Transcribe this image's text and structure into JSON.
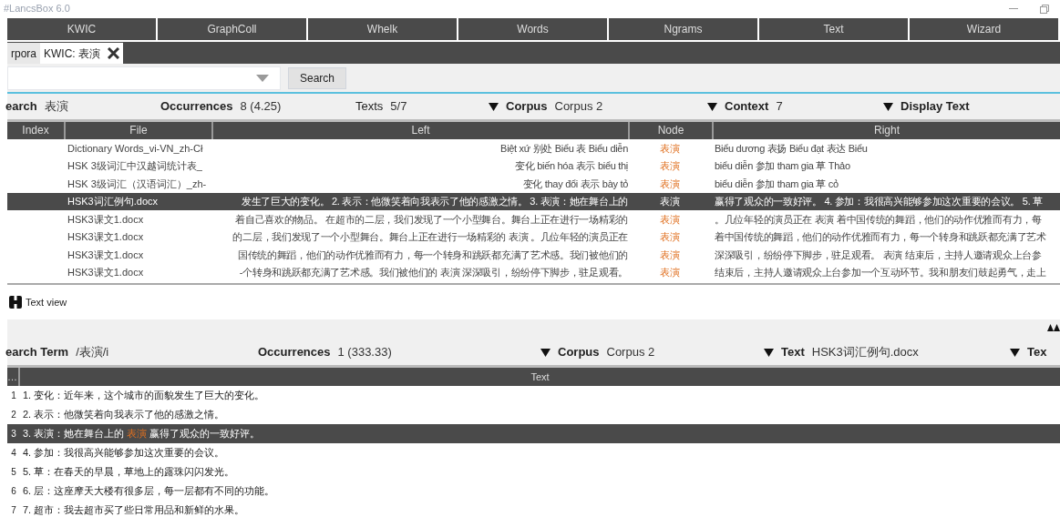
{
  "window": {
    "title": "#LancsBox 6.0"
  },
  "modules": [
    {
      "label": "KWIC",
      "selected": false
    },
    {
      "label": "GraphColl",
      "selected": false
    },
    {
      "label": "Whelk",
      "selected": false
    },
    {
      "label": "Words",
      "selected": false
    },
    {
      "label": "Ngrams",
      "selected": false
    },
    {
      "label": "Text",
      "selected": false
    },
    {
      "label": "Wizard",
      "selected": false
    }
  ],
  "doc_tabs": [
    {
      "label": "rpora",
      "selected": false,
      "closable": false
    },
    {
      "label": "KWIC: 表演",
      "selected": true,
      "closable": true
    }
  ],
  "search": {
    "button": "Search"
  },
  "kwic_info": [
    {
      "label": "earch",
      "value": "表演",
      "bold": true,
      "dropdown": false
    },
    {
      "label": "Occurrences",
      "value": "8 (4.25)",
      "bold": true,
      "dropdown": false
    },
    {
      "label": "Texts",
      "value": "5/7",
      "bold": false,
      "dropdown": false
    },
    {
      "label": "Corpus",
      "value": "Corpus 2",
      "bold": true,
      "dropdown": true
    },
    {
      "label": "Context",
      "value": "7",
      "bold": true,
      "dropdown": true
    },
    {
      "label": "Display Text",
      "bold": true,
      "dropdown": true
    }
  ],
  "kwic_table": {
    "columns": [
      "Index",
      "File",
      "Left",
      "Node",
      "Right"
    ],
    "rows": [
      {
        "file": "Dictionary Words_vi-VN_zh-Cł",
        "left": "Biệt xứ 别处 Biểu 表 Biểu diễn",
        "node": "表演",
        "right": "Biểu dương 表扬 Biểu đạt 表达 Biểu",
        "selected": false
      },
      {
        "file": "HSK 3级词汇中汉越词统计表_",
        "left": "变化 biến hóa 表示 biểu thị",
        "node": "表演",
        "right": "biểu diễn 参加 tham gia 草 Thảo",
        "selected": false
      },
      {
        "file": "HSK 3级词汇（汉语词汇）_zh-",
        "left": "变化 thay đổi 表示 bày tỏ",
        "node": "表演",
        "right": "biểu diễn 参加 tham gia 草 cỏ",
        "selected": false
      },
      {
        "file": "HSK3词汇例句.docx",
        "left": "发生了巨大的变化。 2. 表示：他微笑着向我表示了他的感激之情。 3. 表演：她在舞台上的",
        "node": "表演",
        "right": "赢得了观众的一致好评。 4. 参加：我很高兴能够参加这次重要的会议。 5. 草",
        "selected": true
      },
      {
        "file": "HSK3课文1.docx",
        "left": "着自己喜欢的物品。 在超市的二层，我们发现了一个小型舞台。舞台上正在进行一场精彩的",
        "node": "表演",
        "right": "。几位年轻的演员正在 表演 着中国传统的舞蹈，他们的动作优雅而有力，每",
        "selected": false
      },
      {
        "file": "HSK3课文1.docx",
        "left": "的二层，我们发现了一个小型舞台。舞台上正在进行一场精彩的 表演 。几位年轻的演员正在",
        "node": "表演",
        "right": "着中国传统的舞蹈，他们的动作优雅而有力，每一个转身和跳跃都充满了艺术",
        "selected": false
      },
      {
        "file": "HSK3课文1.docx",
        "left": "国传统的舞蹈，他们的动作优雅而有力，每一个转身和跳跃都充满了艺术感。我们被他们的",
        "node": "表演",
        "right": "深深吸引，纷纷停下脚步，驻足观看。 表演 结束后，主持人邀请观众上台参",
        "selected": false
      },
      {
        "file": "HSK3课文1.docx",
        "left": "-个转身和跳跃都充满了艺术感。我们被他们的 表演 深深吸引，纷纷停下脚步，驻足观看。",
        "node": "表演",
        "right": "结束后，主持人邀请观众上台参加一个互动环节。我和朋友们鼓起勇气，走上",
        "selected": false
      }
    ]
  },
  "text_view": {
    "title": "Text view",
    "info": [
      {
        "label": "earch Term",
        "value": "/表演/i",
        "bold": true,
        "dropdown": false
      },
      {
        "label": "Occurrences",
        "value": "1 (333.33)",
        "bold": true,
        "dropdown": false
      },
      {
        "label": "Corpus",
        "value": "Corpus 2",
        "bold": true,
        "dropdown": true
      },
      {
        "label": "Text",
        "value": "HSK3词汇例句.docx",
        "bold": true,
        "dropdown": true
      },
      {
        "label": "Tex",
        "bold": true,
        "dropdown": true
      }
    ],
    "columns": [
      "…",
      "Text"
    ],
    "lines": [
      {
        "index": "1",
        "selected": false,
        "segments": [
          {
            "text": "1. 变化：近年来，这个城市的面貌发生了巨大的变化。",
            "hit": false
          }
        ]
      },
      {
        "index": "2",
        "selected": false,
        "segments": [
          {
            "text": "2. 表示：他微笑着向我表示了他的感激之情。",
            "hit": false
          }
        ]
      },
      {
        "index": "3",
        "selected": true,
        "segments": [
          {
            "text": "3. 表演：她在舞台上的 ",
            "hit": false
          },
          {
            "text": "表演",
            "hit": true
          },
          {
            "text": " 赢得了观众的一致好评。",
            "hit": false
          }
        ]
      },
      {
        "index": "4",
        "selected": false,
        "segments": [
          {
            "text": "4. 参加：我很高兴能够参加这次重要的会议。",
            "hit": false
          }
        ]
      },
      {
        "index": "5",
        "selected": false,
        "segments": [
          {
            "text": "5. 草：在春天的早晨，草地上的露珠闪闪发光。",
            "hit": false
          }
        ]
      },
      {
        "index": "6",
        "selected": false,
        "segments": [
          {
            "text": "6. 层：这座摩天大楼有很多层，每一层都有不同的功能。",
            "hit": false
          }
        ]
      },
      {
        "index": "7",
        "selected": false,
        "segments": [
          {
            "text": "7. 超市：我去超市买了些日常用品和新鲜的水果。",
            "hit": false
          }
        ]
      }
    ]
  }
}
